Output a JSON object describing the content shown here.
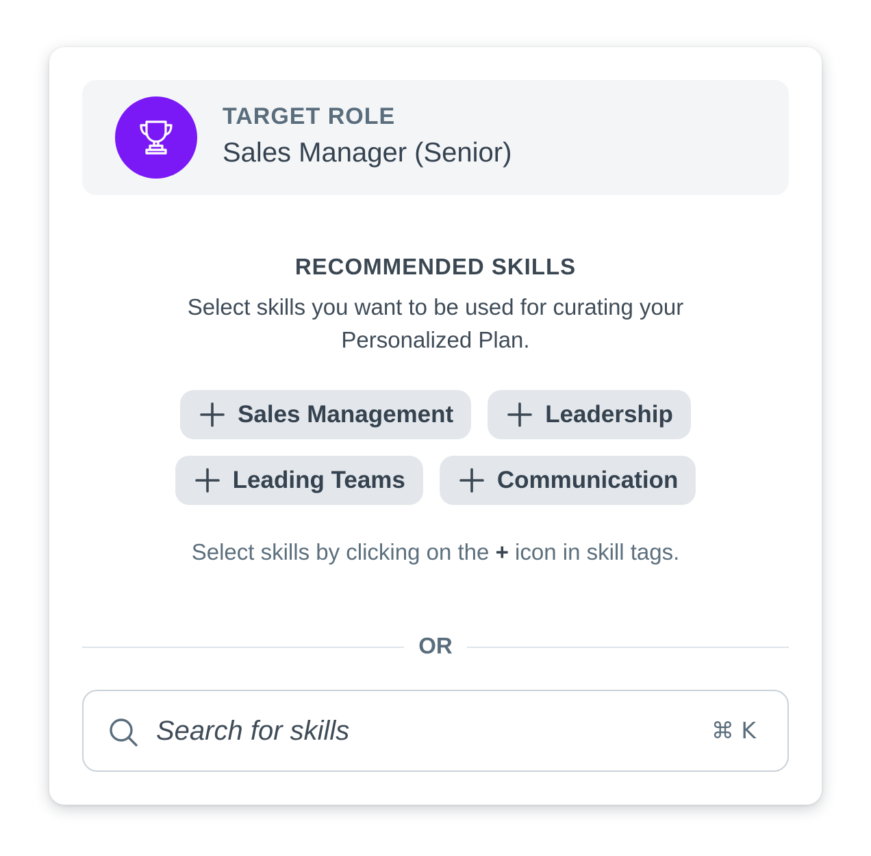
{
  "target_role": {
    "label": "TARGET ROLE",
    "value": "Sales Manager (Senior)",
    "icon": "trophy-icon",
    "icon_bg_color": "#7b19f6"
  },
  "recommended": {
    "title": "RECOMMENDED SKILLS",
    "description": "Select skills you want to be used for curating your Personalized Plan.",
    "tags": [
      {
        "label": "Sales Management",
        "icon": "plus-icon"
      },
      {
        "label": "Leadership",
        "icon": "plus-icon"
      },
      {
        "label": "Leading Teams",
        "icon": "plus-icon"
      },
      {
        "label": "Communication",
        "icon": "plus-icon"
      }
    ],
    "hint_before": "Select skills by clicking on the",
    "hint_plus": "+",
    "hint_after": "icon in skill tags."
  },
  "divider": {
    "text": "OR"
  },
  "search": {
    "placeholder": "Search for skills",
    "shortcut": "⌘ K",
    "icon": "search-icon"
  }
}
